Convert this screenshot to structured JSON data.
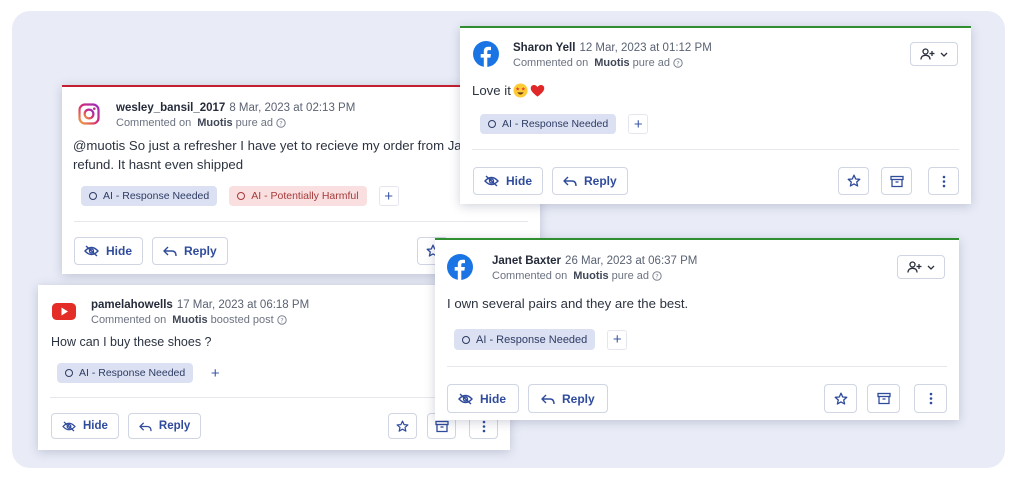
{
  "common": {
    "hide_label": "Hide",
    "reply_label": "Reply",
    "commented_on": "Commented on"
  },
  "colors": {
    "instagram_accent": "#c41f2f",
    "facebook_accent": "#2f8e2f",
    "facebook_blue": "#1b74e4",
    "youtube_red": "#e52d27",
    "button_text": "#2f4b9c"
  },
  "cards": {
    "instagram": {
      "platform_icon": "instagram-icon",
      "username": "wesley_bansil_2017",
      "timestamp": "8 Mar, 2023 at 02:13 PM",
      "page": "Muotis",
      "post_type": "pure ad",
      "body_line1": "@muotis So just a refresher I have yet to recieve my order from January.",
      "body_line2": "refund. It hasnt even shipped",
      "tags": [
        "AI - Response Needed",
        "AI - Potentially Harmful"
      ]
    },
    "youtube": {
      "platform_icon": "youtube-icon",
      "username": "pamelahowells",
      "timestamp": "17 Mar, 2023 at 06:18 PM",
      "page": "Muotis",
      "post_type": "boosted post",
      "body": "How can I buy these shoes ?",
      "tags": [
        "AI - Response Needed"
      ]
    },
    "sharon": {
      "platform_icon": "facebook-icon",
      "username": "Sharon Yell",
      "timestamp": "12 Mar, 2023 at 01:12 PM",
      "page": "Muotis",
      "post_type": "pure ad",
      "body": "Love it",
      "emojis": [
        "star-struck-emoji",
        "heart-emoji"
      ],
      "tags": [
        "AI - Response Needed"
      ]
    },
    "janet": {
      "platform_icon": "facebook-icon",
      "username": "Janet Baxter",
      "timestamp": "26 Mar, 2023 at 06:37 PM",
      "page": "Muotis",
      "post_type": "pure ad",
      "body": "I own several pairs and they are the best.",
      "tags": [
        "AI - Response Needed"
      ]
    }
  }
}
